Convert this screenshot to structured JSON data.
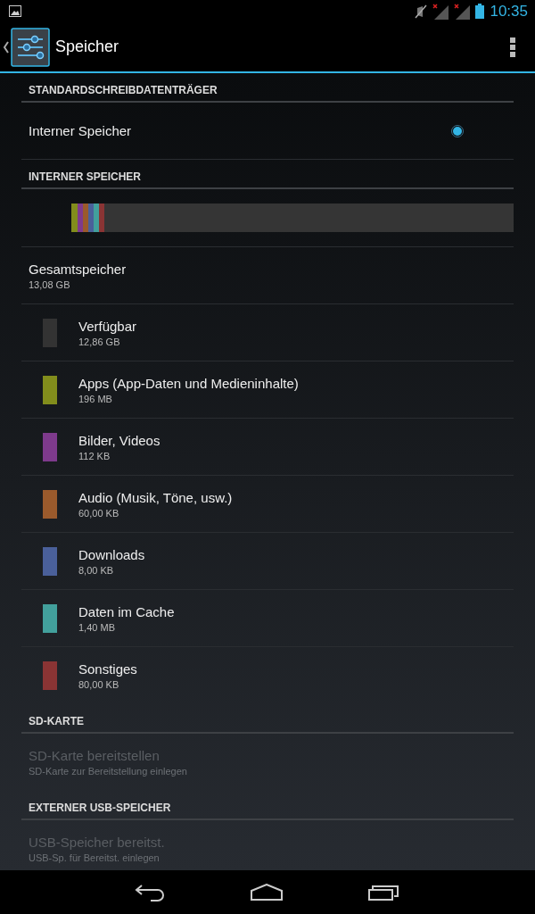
{
  "status_bar": {
    "time": "10:35"
  },
  "action_bar": {
    "title": "Speicher"
  },
  "sections": [
    {
      "kind": "radio",
      "header": "STANDARDSCHREIBDATENTRÄGER",
      "items": [
        {
          "label": "Interner Speicher",
          "selected": true
        }
      ]
    },
    {
      "kind": "storage",
      "header": "INTERNER SPEICHER",
      "total": {
        "label": "Gesamtspeicher",
        "value": "13,08 GB"
      },
      "categories": [
        {
          "label": "Verfügbar",
          "value": "12,86 GB",
          "color": "#333333"
        },
        {
          "label": "Apps (App-Daten und Medieninhalte)",
          "value": "196 MB",
          "color": "#828d1c",
          "level": 0.015
        },
        {
          "label": "Bilder, Videos",
          "value": "112 KB",
          "color": "#7e3a8c",
          "level": 0.012
        },
        {
          "label": "Audio (Musik, Töne, usw.)",
          "value": "60,00 KB",
          "color": "#9a5a2c",
          "level": 0.012
        },
        {
          "label": "Downloads",
          "value": "8,00 KB",
          "color": "#4a609a",
          "level": 0.012
        },
        {
          "label": "Daten im Cache",
          "value": "1,40 MB",
          "color": "#42a09c",
          "level": 0.012
        },
        {
          "label": "Sonstiges",
          "value": "80,00 KB",
          "color": "#8a3434",
          "level": 0.012
        }
      ]
    },
    {
      "kind": "plain",
      "header": "SD-KARTE",
      "items": [
        {
          "label": "SD-Karte bereitstellen",
          "summary": "SD-Karte zur Bereitstellung einlegen",
          "disabled": true
        }
      ]
    },
    {
      "kind": "plain",
      "header": "EXTERNER USB-SPEICHER",
      "items": [
        {
          "label": "USB-Speicher bereitst.",
          "summary": "USB-Sp. für Bereitst. einlegen",
          "disabled": true
        }
      ]
    }
  ]
}
